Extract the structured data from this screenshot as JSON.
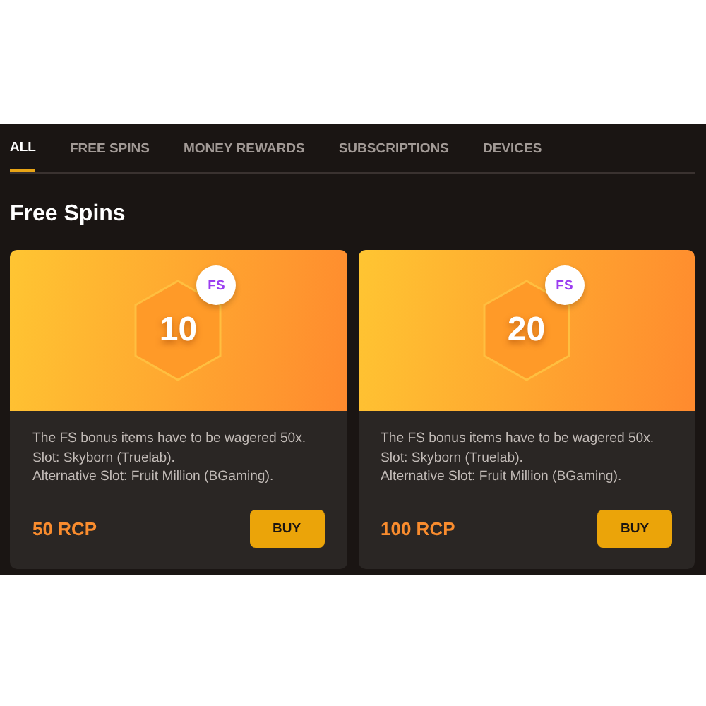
{
  "tabs": [
    {
      "label": "ALL",
      "selected": true
    },
    {
      "label": "FREE SPINS",
      "selected": false
    },
    {
      "label": "MONEY REWARDS",
      "selected": false
    },
    {
      "label": "SUBSCRIPTIONS",
      "selected": false
    },
    {
      "label": "DEVICES",
      "selected": false
    }
  ],
  "section_title": "Free Spins",
  "offers": [
    {
      "amount": "10",
      "badge": "FS",
      "description": "The FS bonus items have to be wagered 50x. Slot: Skyborn (Truelab).\nAlternative Slot: Fruit Million (BGaming).",
      "price": "50 RCP",
      "button": "BUY"
    },
    {
      "amount": "20",
      "badge": "FS",
      "description": "The FS bonus items have to be wagered 50x. Slot: Skyborn (Truelab).\nAlternative Slot: Fruit Million (BGaming).",
      "price": "100 RCP",
      "button": "BUY"
    }
  ]
}
